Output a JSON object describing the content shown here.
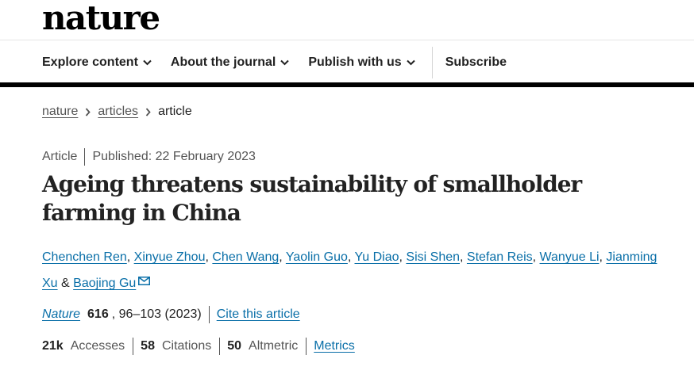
{
  "header": {
    "logo": "nature"
  },
  "nav": {
    "items": [
      {
        "label": "Explore content"
      },
      {
        "label": "About the journal"
      },
      {
        "label": "Publish with us"
      }
    ],
    "subscribe": "Subscribe"
  },
  "breadcrumb": [
    "nature",
    "articles",
    "article"
  ],
  "article": {
    "type": "Article",
    "published": "Published: 22 February 2023",
    "title": "Ageing threatens sustainability of smallholder farming in China",
    "authors": [
      "Chenchen Ren",
      "Xinyue Zhou",
      "Chen Wang",
      "Yaolin Guo",
      "Yu Diao",
      "Sisi Shen",
      "Stefan Reis",
      "Wanyue Li",
      "Jianming Xu",
      "Baojing Gu"
    ],
    "author_sep": ", ",
    "author_last_sep": " & ",
    "citation": {
      "journal": "Nature",
      "volume": "616",
      "pages_year": ", 96–103 (2023)",
      "cite_link": "Cite this article"
    },
    "metrics": {
      "accesses_num": "21k",
      "accesses_label": "Accesses",
      "citations_num": "58",
      "citations_label": "Citations",
      "altmetric_num": "50",
      "altmetric_label": "Altmetric",
      "link": "Metrics"
    }
  },
  "icons": [
    "chevron-down-icon",
    "chevron-right-icon",
    "mail-icon"
  ],
  "colors": {
    "link": "#0a6fa8",
    "text": "#222222",
    "muted": "#555555",
    "nav_bar": "#000000"
  }
}
